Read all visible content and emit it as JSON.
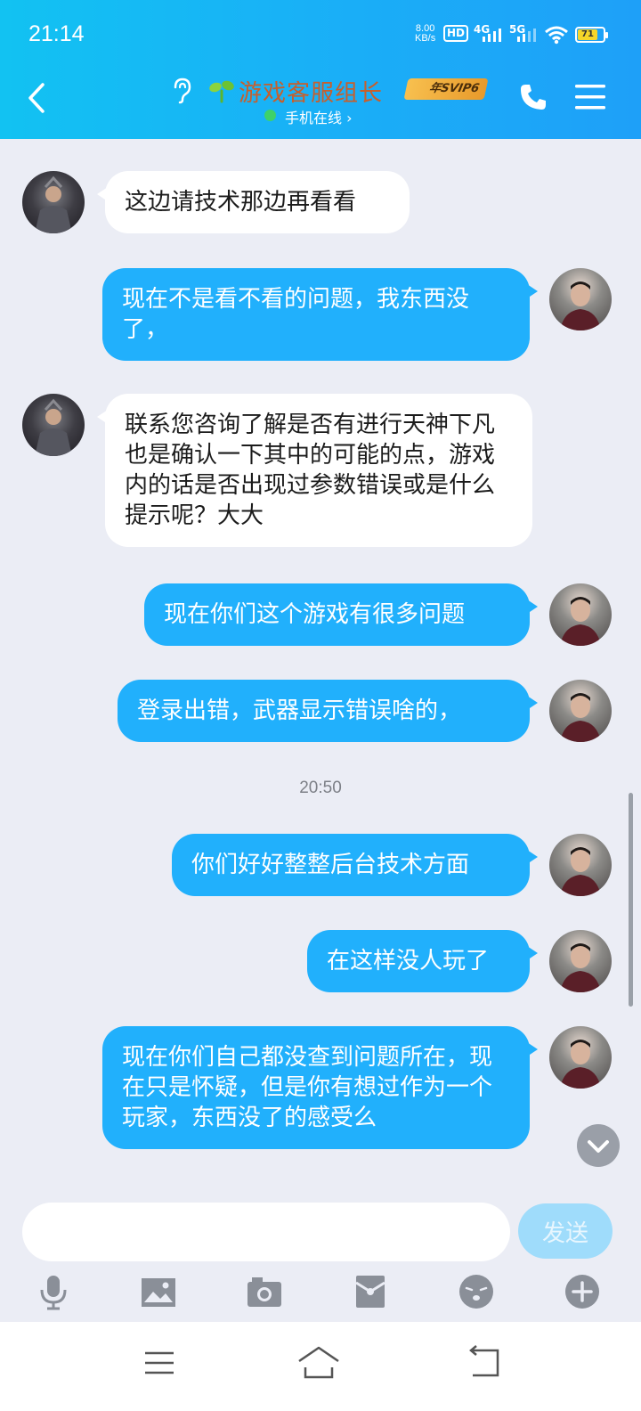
{
  "status_bar": {
    "time": "21:14",
    "net_speed_value": "8.00",
    "net_speed_unit": "KB/s",
    "hd_label": "HD",
    "net_4g": "4G",
    "net_5g": "5G",
    "battery_level": "71"
  },
  "header": {
    "contact_name": "游戏客服组长",
    "svip_badge": "年SVIP6",
    "online_status": "手机在线 ›",
    "accent_color": "#1aaef7"
  },
  "messages": [
    {
      "side": "in",
      "text": "这边请技术那边再看看"
    },
    {
      "side": "out",
      "text": "现在不是看不看的问题，我东西没了，"
    },
    {
      "side": "in",
      "text": "联系您咨询了解是否有进行天神下凡也是确认一下其中的可能的点，游戏内的话是否出现过参数错误或是什么提示呢？大大"
    },
    {
      "side": "out",
      "text": "现在你们这个游戏有很多问题"
    },
    {
      "side": "out",
      "text": "登录出错，武器显示错误啥的，"
    },
    {
      "side": "out",
      "text": "你们好好整整后台技术方面"
    },
    {
      "side": "out",
      "text": "在这样没人玩了"
    },
    {
      "side": "out",
      "text": "现在你们自己都没查到问题所在，现在只是怀疑，但是你有想过作为一个玩家，东西没了的感受么"
    }
  ],
  "timestamp": "20:50",
  "input": {
    "value": "",
    "send_label": "发送"
  },
  "toolbar_icons": [
    "microphone-icon",
    "image-icon",
    "camera-icon",
    "red-packet-icon",
    "emoji-icon",
    "plus-icon"
  ],
  "nav_icons": [
    "menu-icon",
    "home-icon",
    "back-icon"
  ]
}
